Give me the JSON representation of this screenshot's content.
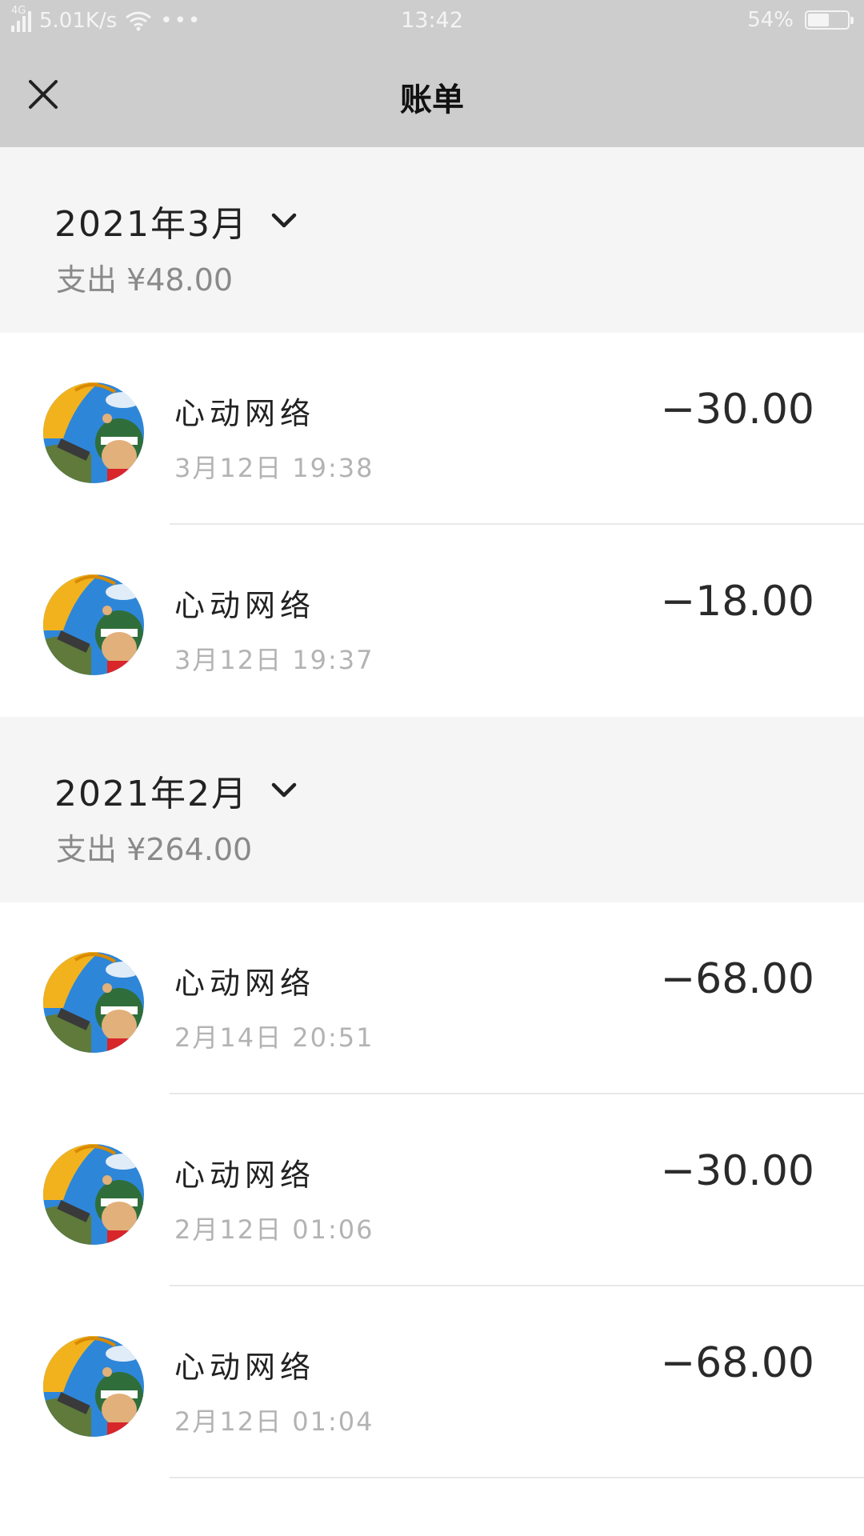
{
  "status_bar": {
    "network_tag": "4G",
    "speed": "5.01K/s",
    "dots": "•••",
    "time": "13:42",
    "battery_text": "54%",
    "battery_level": 0.54
  },
  "header": {
    "title": "账单",
    "close_icon": "close-icon"
  },
  "months": [
    {
      "title": "2021年3月",
      "summary": "支出 ¥48.00",
      "items": [
        {
          "name": "心动网络",
          "time": "3月12日 19:38",
          "amount": "−30.00"
        },
        {
          "name": "心动网络",
          "time": "3月12日 19:37",
          "amount": "−18.00"
        }
      ]
    },
    {
      "title": "2021年2月",
      "summary": "支出 ¥264.00",
      "items": [
        {
          "name": "心动网络",
          "time": "2月14日 20:51",
          "amount": "−68.00"
        },
        {
          "name": "心动网络",
          "time": "2月12日 01:06",
          "amount": "−30.00"
        },
        {
          "name": "心动网络",
          "time": "2月12日 01:04",
          "amount": "−68.00"
        }
      ]
    }
  ],
  "colors": {
    "bar_bg": "#cdcdcd",
    "month_bg": "#f5f5f5",
    "muted_text": "#8a8a8a"
  }
}
